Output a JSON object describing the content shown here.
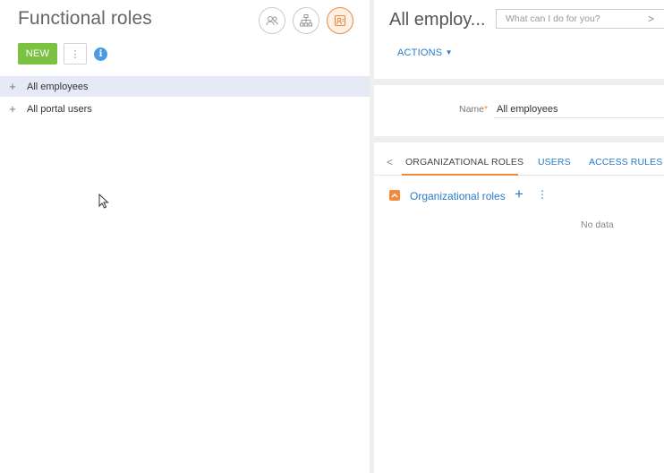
{
  "left_panel": {
    "title": "Functional roles",
    "new_button": "NEW",
    "more_button": "⋮",
    "info_icon": "i",
    "view_buttons": [
      "users-view-icon",
      "org-structure-icon",
      "functional-roles-icon"
    ],
    "tree": [
      {
        "expander": "+",
        "label": "All employees",
        "selected": true
      },
      {
        "expander": "+",
        "label": "All portal users",
        "selected": false
      }
    ]
  },
  "right_panel": {
    "title": "All employ...",
    "command_placeholder": "What can I do for you?",
    "command_arrow": ">",
    "actions_label": "ACTIONS",
    "name_field": {
      "label": "Name",
      "required_marker": "*",
      "value": "All employees"
    },
    "tabs": [
      {
        "label": "ORGANIZATIONAL ROLES",
        "active": true
      },
      {
        "label": "USERS",
        "active": false
      },
      {
        "label": "ACCESS RULES",
        "active": false
      }
    ],
    "tabs_prev": "<",
    "detail": {
      "title": "Organizational roles",
      "add": "+",
      "more": "⋮",
      "empty_text": "No data"
    }
  },
  "colors": {
    "accent_orange": "#f08b3c",
    "new_green": "#7cc242",
    "link_blue": "#2a7ac6",
    "selected_row": "#e6eaf6"
  }
}
